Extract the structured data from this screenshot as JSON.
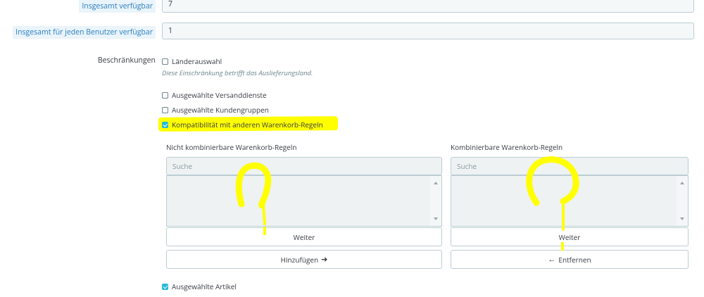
{
  "fields": {
    "total_available_label": "Insgesamt verfügbar",
    "total_available_value": "7",
    "per_user_label": "Insgesamt für jeden Benutzer verfügbar",
    "per_user_value": "1"
  },
  "restrictions": {
    "label": "Beschränkungen",
    "country": {
      "label": "Länderauswahl",
      "checked": false
    },
    "country_hint": "Diese Einschränkung betrifft das Auslieferungsland.",
    "carrier": {
      "label": "Ausgewählte Versanddienste",
      "checked": false
    },
    "groups": {
      "label": "Ausgewählte Kundengruppen",
      "checked": false
    },
    "compat": {
      "label": "Kompatibilität mit anderen Warenkorb-Regeln",
      "checked": true
    },
    "products": {
      "label": "Ausgewählte Artikel",
      "checked": true
    }
  },
  "left_panel": {
    "title": "Nicht kombinierbare Warenkorb-Regeln",
    "search_placeholder": "Suche",
    "next_label": "Weiter",
    "action_label": "Hinzufügen"
  },
  "right_panel": {
    "title": "Kombinierbare Warenkorb-Regeln",
    "search_placeholder": "Suche",
    "next_label": "Weiter",
    "action_label": "Entfernen"
  },
  "colors": {
    "accent": "#25b9d7",
    "highlight": "#ffff00",
    "label_blue": "#2b7fbf"
  }
}
